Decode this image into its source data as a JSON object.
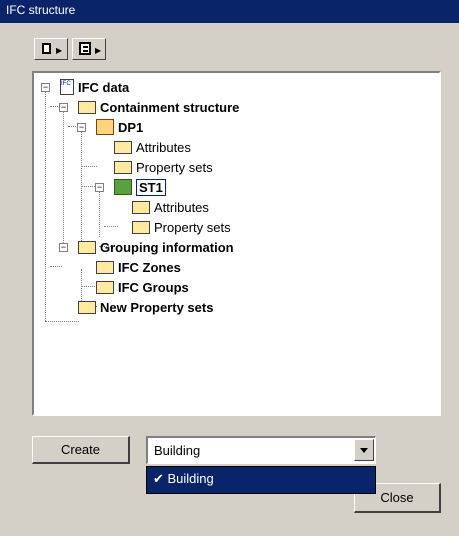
{
  "window": {
    "title": "IFC structure"
  },
  "toolbar": {
    "btn1_icon": "box-arrow-icon",
    "btn2_icon": "table-arrow-icon"
  },
  "tree": {
    "root": "IFC data",
    "containment": "Containment structure",
    "dp1": "DP1",
    "dp1_attributes": "Attributes",
    "dp1_property_sets": "Property sets",
    "st1": "ST1",
    "st1_attributes": "Attributes",
    "st1_property_sets": "Property sets",
    "grouping": "Grouping information",
    "zones": "IFC Zones",
    "groups": "IFC Groups",
    "new_property_sets": "New Property sets"
  },
  "buttons": {
    "create": "Create",
    "close": "Close"
  },
  "combo": {
    "selected": "Building",
    "options": [
      "Building"
    ],
    "checked_option": "✔ Building"
  },
  "colors": {
    "titlebar": "#0a246a",
    "folder": "#ffeaa0",
    "selection": "#0a246a"
  }
}
